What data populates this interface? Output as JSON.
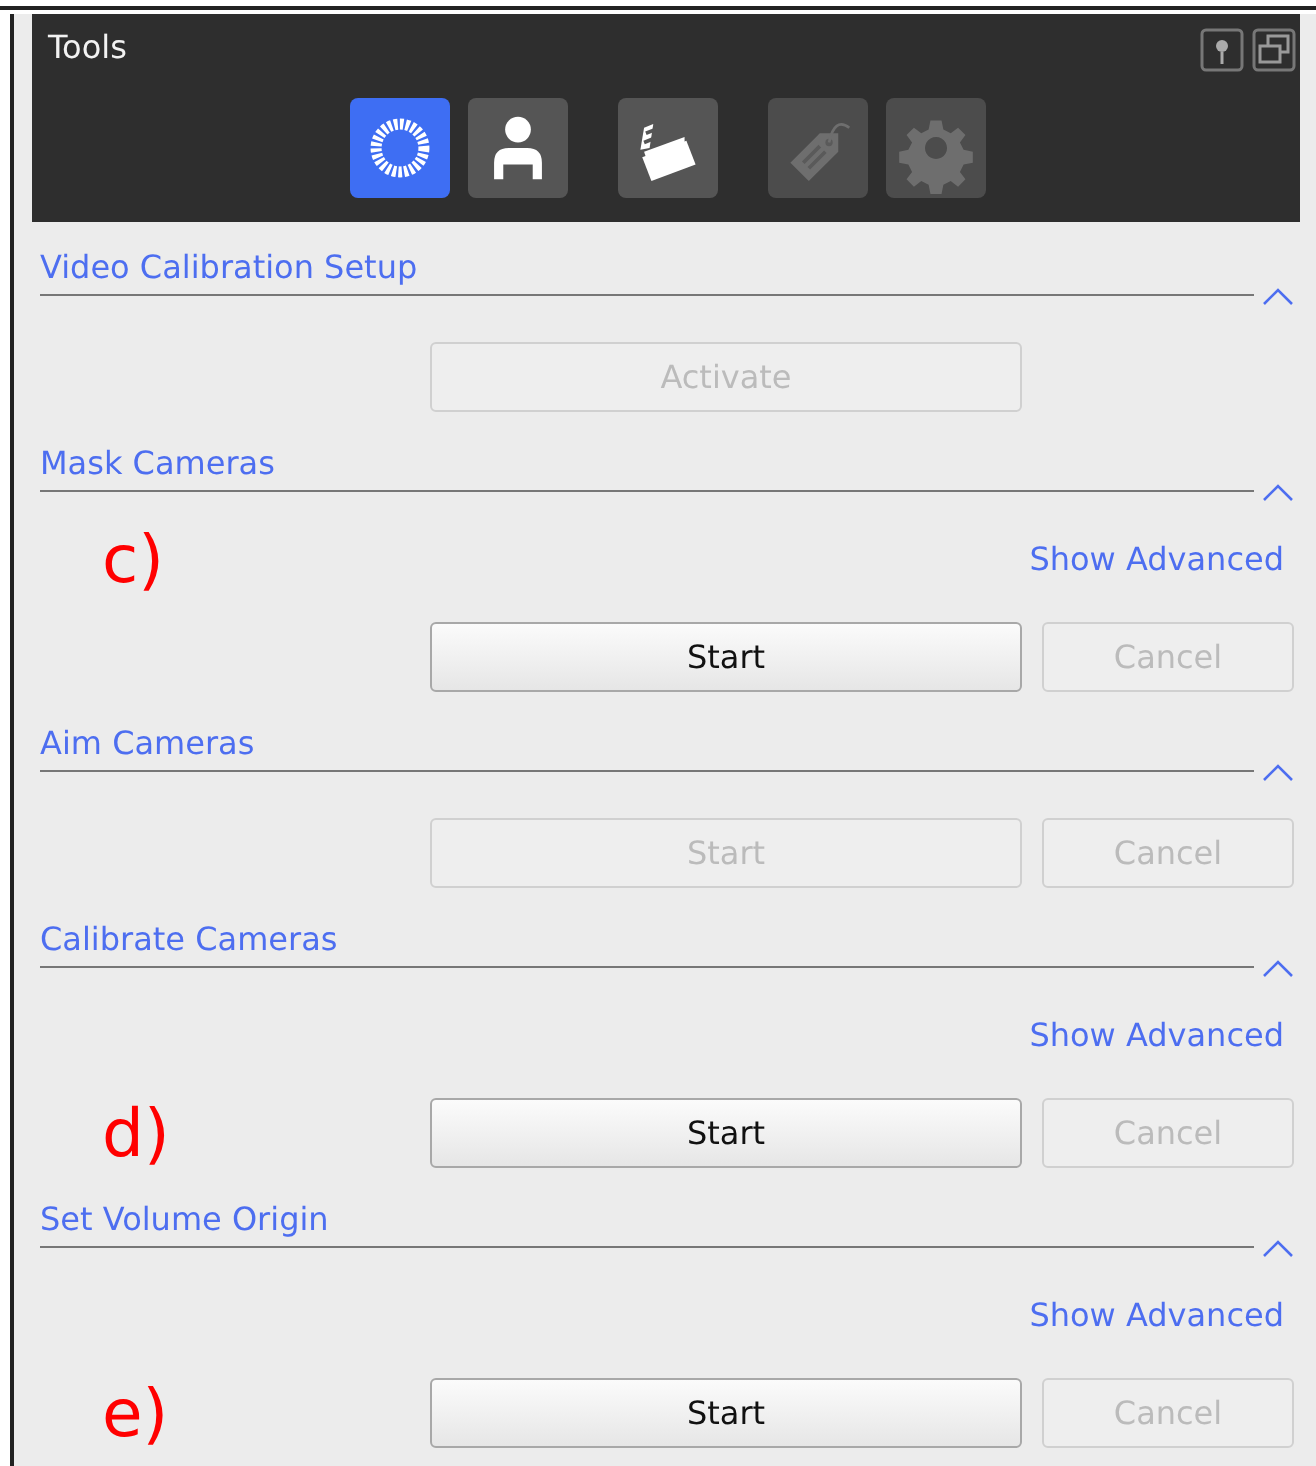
{
  "panel": {
    "title": "Tools"
  },
  "toolbar": [
    {
      "kind": "target",
      "selected": true,
      "disabled": false
    },
    {
      "kind": "person",
      "selected": false,
      "disabled": false
    },
    {
      "kind": "clapper",
      "selected": false,
      "disabled": false
    },
    {
      "kind": "tag",
      "selected": false,
      "disabled": true
    },
    {
      "kind": "gear",
      "selected": false,
      "disabled": true
    }
  ],
  "sections": [
    {
      "title": "Video Calibration Setup",
      "expanded": true,
      "buttons": [
        {
          "kind": "wide",
          "label": "Activate",
          "disabled": true
        }
      ]
    },
    {
      "title": "Mask Cameras",
      "expanded": true,
      "annotation": {
        "text": "c)",
        "kind": "advanced"
      },
      "show_advanced": "Show Advanced",
      "buttons": [
        {
          "kind": "wide",
          "label": "Start",
          "disabled": false
        },
        {
          "kind": "narrow",
          "label": "Cancel",
          "disabled": true
        }
      ]
    },
    {
      "title": "Aim Cameras",
      "expanded": true,
      "buttons": [
        {
          "kind": "wide",
          "label": "Start",
          "disabled": true
        },
        {
          "kind": "narrow",
          "label": "Cancel",
          "disabled": true
        }
      ]
    },
    {
      "title": "Calibrate Cameras",
      "expanded": true,
      "annotation": {
        "text": "d)",
        "kind": "buttons"
      },
      "show_advanced": "Show Advanced",
      "buttons": [
        {
          "kind": "wide",
          "label": "Start",
          "disabled": false
        },
        {
          "kind": "narrow",
          "label": "Cancel",
          "disabled": true
        }
      ]
    },
    {
      "title": "Set Volume Origin",
      "expanded": true,
      "annotation": {
        "text": "e)",
        "kind": "buttons"
      },
      "show_advanced": "Show Advanced",
      "buttons": [
        {
          "kind": "wide",
          "label": "Start",
          "disabled": false
        },
        {
          "kind": "narrow",
          "label": "Cancel",
          "disabled": true
        }
      ]
    }
  ]
}
